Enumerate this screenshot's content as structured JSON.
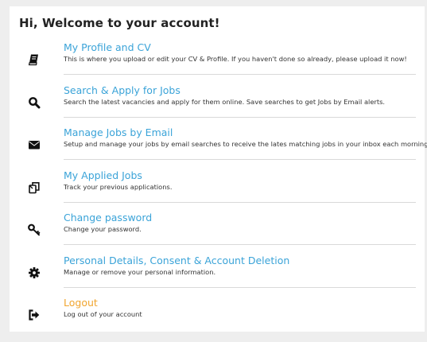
{
  "page": {
    "title": "Hi, Welcome to your account!"
  },
  "items": [
    {
      "label": "My Profile and CV",
      "description": "This is where you upload or edit your CV & Profile. If you haven't done so already, please upload it now!",
      "icon": "book-icon"
    },
    {
      "label": "Search & Apply for Jobs",
      "description": "Search the latest vacancies and apply for them online. Save searches to get Jobs by Email alerts.",
      "icon": "search-icon"
    },
    {
      "label": "Manage Jobs by Email",
      "description": "Setup and manage your jobs by email searches to receive the lates matching jobs in your inbox each morning.",
      "icon": "envelope-icon"
    },
    {
      "label": "My Applied Jobs",
      "description": "Track your previous applications.",
      "icon": "copy-icon"
    },
    {
      "label": "Change password",
      "description": "Change your password.",
      "icon": "key-icon"
    },
    {
      "label": "Personal Details, Consent & Account Deletion",
      "description": "Manage or remove your personal information.",
      "icon": "gear-icon"
    },
    {
      "label": "Logout",
      "description": "Log out of your account",
      "icon": "sign-out-icon"
    }
  ],
  "colors": {
    "link": "#3aa3d8",
    "logout_link": "#f1a52f",
    "background": "#eeeeee",
    "panel": "#ffffff"
  }
}
